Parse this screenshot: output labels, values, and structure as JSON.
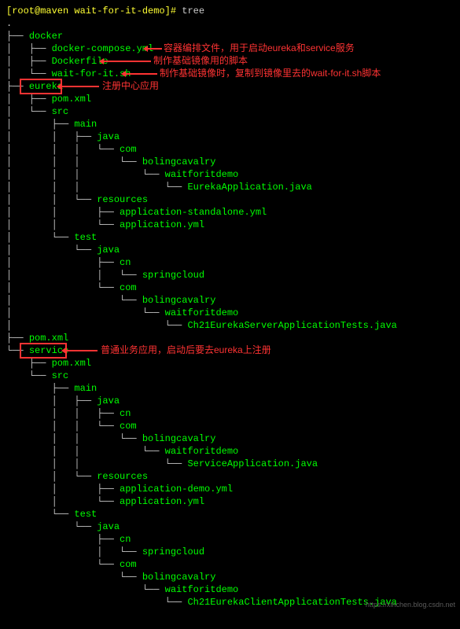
{
  "prompt": {
    "user_host": "[root@maven wait-for-it-demo]# ",
    "command": "tree"
  },
  "dot": ".",
  "tree_nodes": {
    "docker": "docker",
    "docker_compose": "docker-compose.yml",
    "dockerfile": "Dockerfile",
    "wait_for_it": "wait-for-it.sh",
    "eureka": "eureka",
    "pom_xml": "pom.xml",
    "src": "src",
    "main": "main",
    "java": "java",
    "com": "com",
    "cn": "cn",
    "bolingcavalry": "bolingcavalry",
    "waitforitdemo": "waitforitdemo",
    "eureka_app": "EurekaApplication.java",
    "resources": "resources",
    "app_standalone": "application-standalone.yml",
    "app_yml": "application.yml",
    "test": "test",
    "springcloud": "springcloud",
    "eureka_tests": "Ch21EurekaServerApplicationTests.java",
    "service": "service",
    "service_app": "ServiceApplication.java",
    "app_demo": "application-demo.yml",
    "client_tests": "Ch21EurekaClientApplicationTests.java"
  },
  "annotations": {
    "compose": "容器编排文件，用于启动eureka和service服务",
    "dockerfile": "制作基础镜像用的脚本",
    "wait_for_it": "制作基础镜像时，复制到镜像里去的wait-for-it.sh脚本",
    "eureka": "注册中心应用",
    "service": "普通业务应用，启动后要去eureka上注册"
  },
  "watermark": "https://xinchen.blog.csdn.net"
}
